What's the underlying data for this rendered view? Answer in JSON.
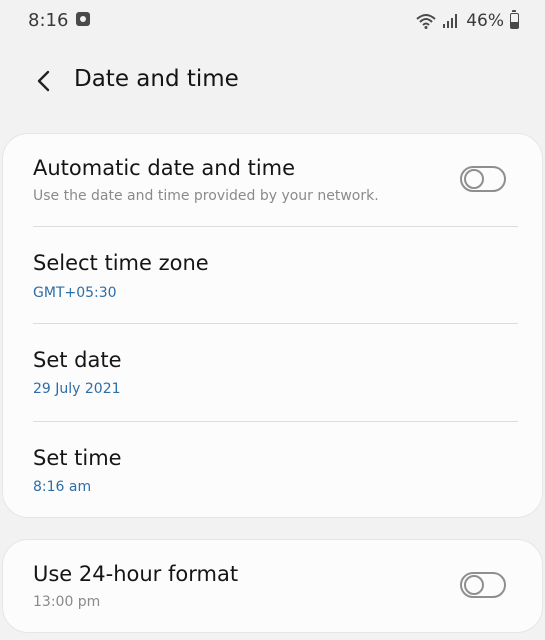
{
  "status_bar": {
    "time": "8:16",
    "battery_percent": "46%",
    "battery_level": 0.46,
    "icons": [
      "notification-icon",
      "wifi-icon",
      "signal-icon",
      "battery-icon"
    ]
  },
  "header": {
    "back_icon": "back-arrow-icon",
    "title": "Date and time"
  },
  "settings": {
    "automatic": {
      "title": "Automatic date and time",
      "subtitle": "Use the date and time provided by your network.",
      "enabled": false
    },
    "time_zone": {
      "title": "Select time zone",
      "value": "GMT+05:30"
    },
    "date": {
      "title": "Set date",
      "value": "29 July 2021"
    },
    "time": {
      "title": "Set time",
      "value": "8:16 am"
    },
    "format_24h": {
      "title": "Use 24-hour format",
      "subtitle": "13:00 pm",
      "enabled": false
    }
  },
  "colors": {
    "accent": "#2e6ea6",
    "background": "#f2f2f2",
    "card": "#fcfcfc"
  }
}
